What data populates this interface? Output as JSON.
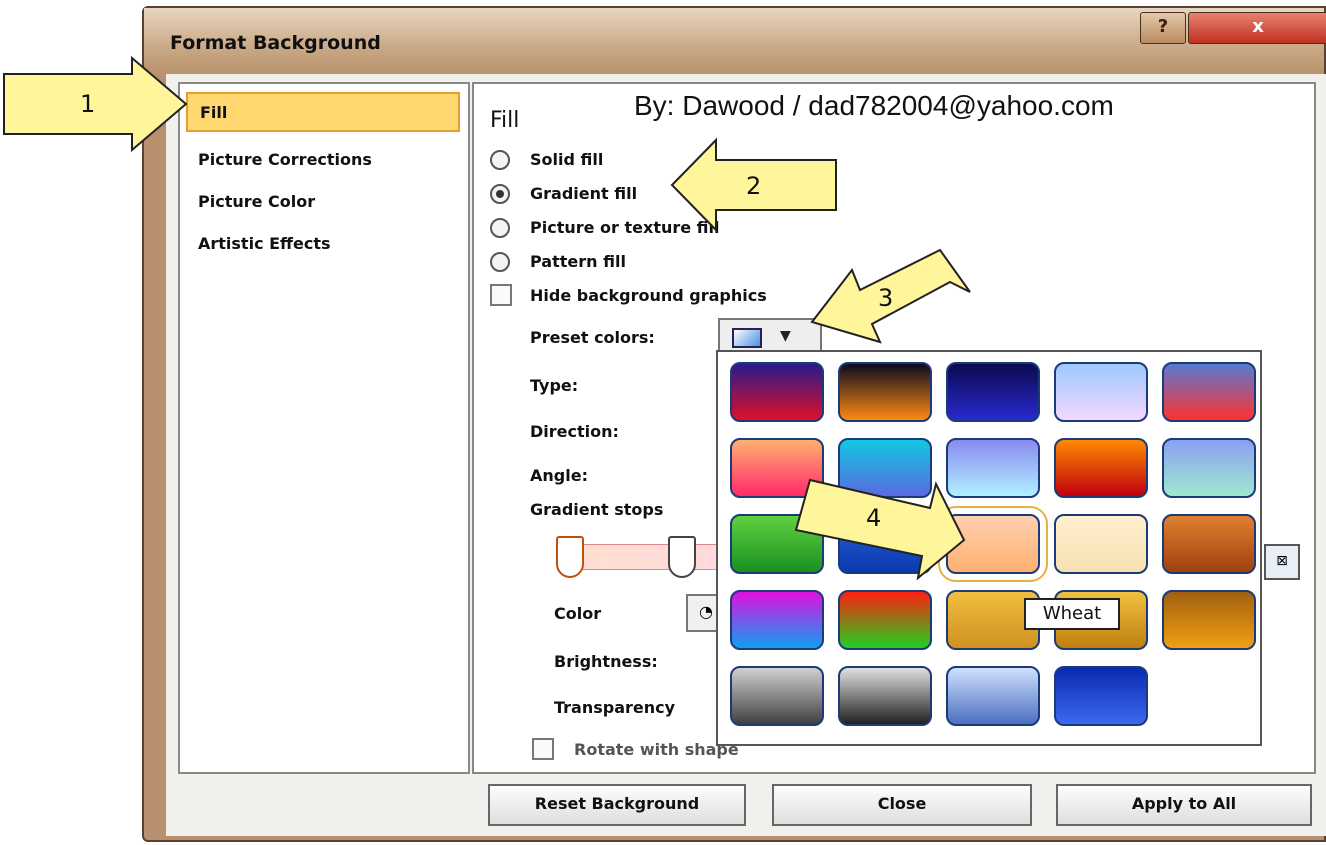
{
  "window": {
    "title": "Format Background",
    "help_label": "?",
    "close_label": "x"
  },
  "nav": {
    "items": [
      {
        "label": "Fill",
        "selected": true
      },
      {
        "label": "Picture Corrections",
        "selected": false
      },
      {
        "label": "Picture Color",
        "selected": false
      },
      {
        "label": "Artistic Effects",
        "selected": false
      }
    ]
  },
  "pane": {
    "title": "Fill",
    "byline": "By: Dawood / dad782004@yahoo.com",
    "fill_options": [
      {
        "label": "Solid fill",
        "selected": false
      },
      {
        "label": "Gradient fill",
        "selected": true
      },
      {
        "label": "Picture or texture fill",
        "selected": false
      },
      {
        "label": "Pattern fill",
        "selected": false
      }
    ],
    "hide_background": {
      "label": "Hide background graphics",
      "checked": false
    },
    "preset_colors_label": "Preset colors:",
    "type_label": "Type:",
    "direction_label": "Direction:",
    "angle_label": "Angle:",
    "gradient_stops_label": "Gradient stops",
    "color_label": "Color",
    "brightness_label": "Brightness:",
    "transparency_label": "Transparency",
    "rotate_label": "Rotate with shape",
    "rotate_checked": false
  },
  "buttons": {
    "reset": "Reset Background",
    "close": "Close",
    "apply_all": "Apply to All"
  },
  "gallery": {
    "hovered": "Wheat",
    "tooltip": "Wheat",
    "swatches": [
      [
        "#2a1a8a",
        "#e0102a"
      ],
      [
        "#0a0a20",
        "#ff8a10"
      ],
      [
        "#0a0a50",
        "#2a2ad0"
      ],
      [
        "#9ec8ff",
        "#f4d8ff"
      ],
      [
        "#5a7ad0",
        "#ff3030"
      ],
      [
        "#ffb070",
        "#ff2a6a"
      ],
      [
        "#10c8e0",
        "#5a6ae0"
      ],
      [
        "#8a8af0",
        "#b0f0ff"
      ],
      [
        "#ff8a00",
        "#c00010"
      ],
      [
        "#8aa0f0",
        "#a0e8d0"
      ],
      [
        "#60d040",
        "#1a9020"
      ],
      [
        "#2a60d0",
        "#0a3ab0"
      ],
      [
        "#ffd0b0",
        "#ffb070"
      ],
      [
        "#fff0d0",
        "#f8e0b0"
      ],
      [
        "#e08030",
        "#a04010"
      ],
      [
        "#e010e0",
        "#10a0f0"
      ],
      [
        "#ff2010",
        "#20d020"
      ],
      [
        "#f0c040",
        "#d09020"
      ],
      [
        "#f0c040",
        "#c08010"
      ],
      [
        "#a06010",
        "#f0a010"
      ],
      [
        "#d0d0d0",
        "#404040"
      ],
      [
        "#e0e0e0",
        "#202020"
      ],
      [
        "#d0e0ff",
        "#4a70c0"
      ],
      [
        "#0a2ab0",
        "#3a6af0"
      ]
    ]
  },
  "callouts": [
    "1",
    "2",
    "3",
    "4"
  ]
}
